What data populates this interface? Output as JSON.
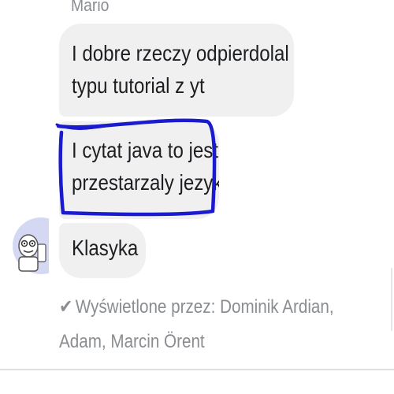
{
  "conversation": {
    "sender_name": "Mario",
    "messages": [
      {
        "text": "I dobre rzeczy odpierdolal\ntypu tutorial z yt",
        "highlighted": false
      },
      {
        "text": "I cytat java to jest\nprzestarzaly jezyk",
        "highlighted": true
      },
      {
        "text": "Klasyka",
        "highlighted": false
      }
    ],
    "seen_by": {
      "icon": "check-icon",
      "line1": "Wyświetlone przez: Dominik Ardian,",
      "line2": "Adam, Marcin Örent"
    }
  },
  "colors": {
    "bubble": "#f0f0f0",
    "text": "#1c1e21",
    "meta_text": "#8a8d91",
    "highlight_stroke": "#1a1acf"
  }
}
